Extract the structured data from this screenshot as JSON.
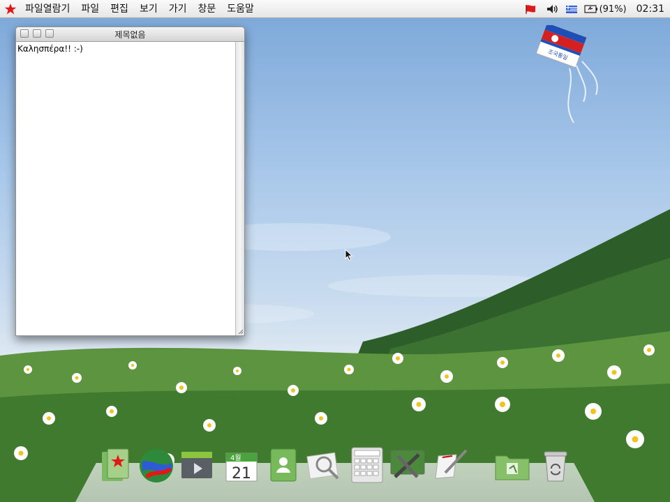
{
  "menubar": {
    "items": [
      "파일열람기",
      "파일",
      "편집",
      "보기",
      "가기",
      "창문",
      "도움말"
    ],
    "battery": "(91%)",
    "clock": "02:31"
  },
  "window": {
    "title": "제목없음",
    "content": "Καλησπέρα!! :-)"
  },
  "kite": {
    "text": "조국통일"
  },
  "calendar": {
    "month": "4월",
    "day": "21"
  },
  "dock": {
    "items": [
      "file-viewer-icon",
      "web-browser-icon",
      "video-player-icon",
      "calendar-icon",
      "address-book-icon",
      "image-viewer-icon",
      "calculator-icon",
      "system-settings-icon",
      "text-editor-icon",
      "folder-icon",
      "trash-icon"
    ]
  },
  "colors": {
    "accent_red": "#e01818",
    "menubar": "#ececec"
  }
}
